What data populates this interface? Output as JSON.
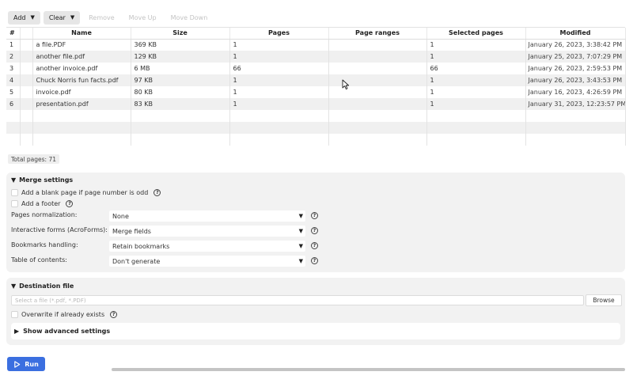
{
  "toolbar": {
    "add_label": "Add",
    "clear_label": "Clear",
    "remove_label": "Remove",
    "move_up_label": "Move Up",
    "move_down_label": "Move Down"
  },
  "table": {
    "columns": [
      "#",
      "Name",
      "Size",
      "Pages",
      "Page ranges",
      "Selected pages",
      "Modified"
    ],
    "rows": [
      {
        "num": "1",
        "name": "a file.PDF",
        "size": "369 KB",
        "pages": "1",
        "ranges": "",
        "selected": "1",
        "modified": "January 26, 2023, 3:38:42 PM"
      },
      {
        "num": "2",
        "name": "another file.pdf",
        "size": "129 KB",
        "pages": "1",
        "ranges": "",
        "selected": "1",
        "modified": "January 25, 2023, 7:07:29 PM"
      },
      {
        "num": "3",
        "name": "another invoice.pdf",
        "size": "6 MB",
        "pages": "66",
        "ranges": "",
        "selected": "66",
        "modified": "January 26, 2023, 2:59:53 PM"
      },
      {
        "num": "4",
        "name": "Chuck Norris fun facts.pdf",
        "size": "97 KB",
        "pages": "1",
        "ranges": "",
        "selected": "1",
        "modified": "January 26, 2023, 3:43:53 PM"
      },
      {
        "num": "5",
        "name": "invoice.pdf",
        "size": "80 KB",
        "pages": "1",
        "ranges": "",
        "selected": "1",
        "modified": "January 16, 2023, 4:26:59 PM"
      },
      {
        "num": "6",
        "name": "presentation.pdf",
        "size": "83 KB",
        "pages": "1",
        "ranges": "",
        "selected": "1",
        "modified": "January 31, 2023, 12:23:57 PM"
      }
    ],
    "total_pages": "Total pages: 71"
  },
  "merge": {
    "title": "Merge settings",
    "blank_page_label": "Add a blank page if page number is odd",
    "footer_label": "Add a footer",
    "settings": [
      {
        "label": "Pages normalization:",
        "value": "None"
      },
      {
        "label": "Interactive forms (AcroForms):",
        "value": "Merge fields"
      },
      {
        "label": "Bookmarks handling:",
        "value": "Retain bookmarks"
      },
      {
        "label": "Table of contents:",
        "value": "Don't generate"
      }
    ]
  },
  "destination": {
    "title": "Destination file",
    "placeholder": "Select a file  (*.pdf, *.PDF)",
    "browse_label": "Browse",
    "overwrite_label": "Overwrite if already exists",
    "advanced_label": "Show advanced settings"
  },
  "run_label": "Run",
  "colors": {
    "accent": "#3b6fe0",
    "panel_bg": "#f2f2f2",
    "row_alt": "#f0f0f0"
  },
  "icons": {
    "dropdown": "caret-down-icon",
    "help": "question-circle-icon",
    "collapse": "triangle-down-icon",
    "expand": "triangle-right-icon",
    "run": "play-icon",
    "cursor": "mouse-pointer-icon"
  }
}
